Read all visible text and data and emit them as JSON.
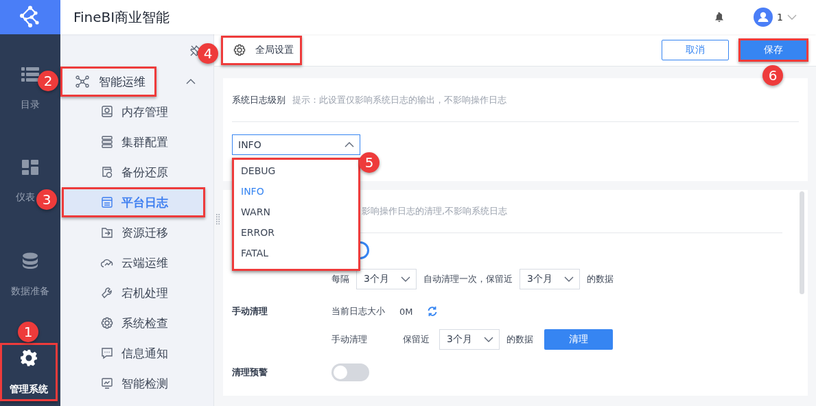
{
  "header": {
    "title": "FineBI商业智能",
    "user": "1"
  },
  "rail": [
    {
      "label": "目录",
      "selected": false
    },
    {
      "label": "仪表",
      "selected": false
    },
    {
      "label": "数据准备",
      "selected": false
    },
    {
      "label": "管理系统",
      "selected": true
    }
  ],
  "menu": {
    "group": {
      "label": "智能运维",
      "expanded": true
    },
    "items": [
      {
        "label": "内存管理",
        "selected": false
      },
      {
        "label": "集群配置",
        "selected": false
      },
      {
        "label": "备份还原",
        "selected": false
      },
      {
        "label": "平台日志",
        "selected": true
      },
      {
        "label": "资源迁移",
        "selected": false
      },
      {
        "label": "云端运维",
        "selected": false
      },
      {
        "label": "宕机处理",
        "selected": false
      },
      {
        "label": "系统检查",
        "selected": false
      },
      {
        "label": "信息通知",
        "selected": false
      },
      {
        "label": "智能检测",
        "selected": false
      }
    ]
  },
  "toolbar": {
    "title": "全局设置",
    "buttons": [
      {
        "label": "取消",
        "kind": "secondary"
      },
      {
        "label": "保存",
        "kind": "primary"
      }
    ]
  },
  "system_log": {
    "label": "系统日志级别",
    "hint": "提示：此设置仅影响系统日志的输出，不影响操作日志",
    "select": {
      "value": "INFO",
      "expanded": true
    },
    "options": [
      {
        "label": "DEBUG",
        "selected": false
      },
      {
        "label": "INFO",
        "selected": true
      },
      {
        "label": "WARN",
        "selected": false
      },
      {
        "label": "ERROR",
        "selected": false
      },
      {
        "label": "FATAL",
        "selected": false
      }
    ]
  },
  "log_cleanup": {
    "hint": "影响操作日志的清理,不影响系统日志",
    "auto_toggle": {
      "on": true
    },
    "auto_row": {
      "every": "每隔",
      "interval": "3个月",
      "middle": "自动清理一次，保留近",
      "keep": "3个月",
      "suffix": "的数据"
    },
    "manual": {
      "label": "手动清理",
      "size_label": "当前日志大小",
      "size": "0M",
      "action_label": "手动清理",
      "keep_label": "保留近",
      "keep": "3个月",
      "suffix": "的数据",
      "button": "清理"
    },
    "warning": {
      "label": "清理预警",
      "on": false
    }
  },
  "annotations": [
    {
      "number": "1"
    },
    {
      "number": "2"
    },
    {
      "number": "3"
    },
    {
      "number": "4"
    },
    {
      "number": "5"
    },
    {
      "number": "6"
    }
  ]
}
